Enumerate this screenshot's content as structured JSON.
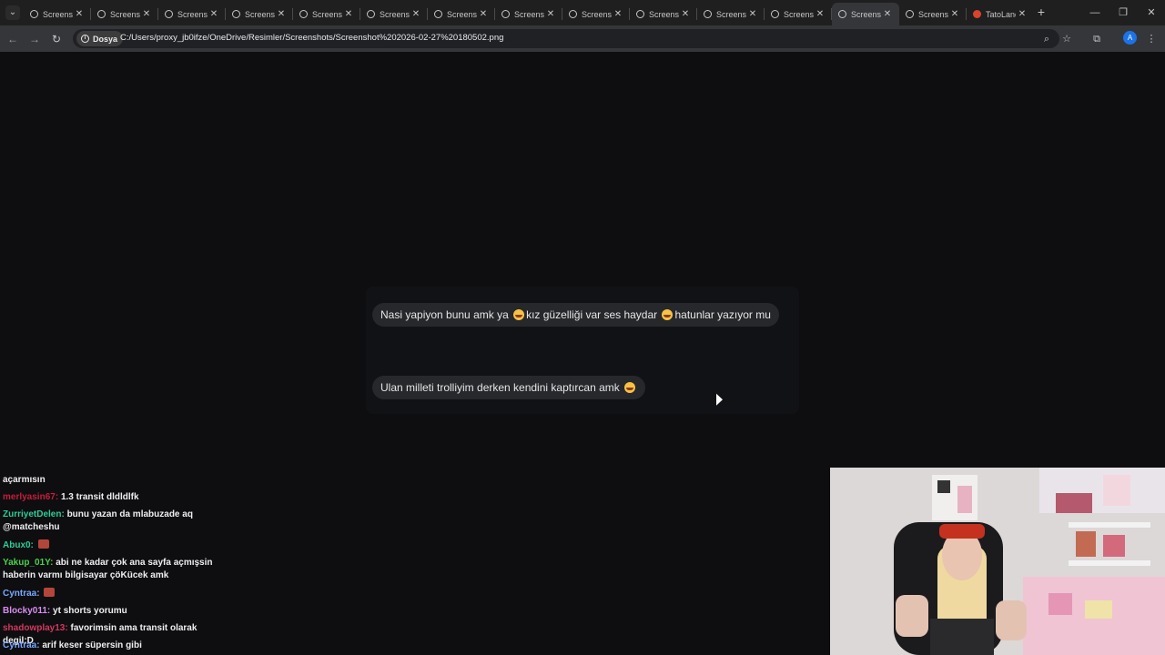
{
  "tabs": [
    {
      "label": "Screenshot",
      "favicon": "globe-icon",
      "active": false
    },
    {
      "label": "Screenshot",
      "favicon": "globe-icon",
      "active": false
    },
    {
      "label": "Screenshot",
      "favicon": "globe-icon",
      "active": false
    },
    {
      "label": "Screenshot",
      "favicon": "globe-icon",
      "active": false
    },
    {
      "label": "Screenshot",
      "favicon": "globe-icon",
      "active": false
    },
    {
      "label": "Screenshot",
      "favicon": "globe-icon",
      "active": false
    },
    {
      "label": "Screenshot",
      "favicon": "globe-icon",
      "active": false
    },
    {
      "label": "Screenshot",
      "favicon": "globe-icon",
      "active": false
    },
    {
      "label": "Screenshot",
      "favicon": "globe-icon",
      "active": false
    },
    {
      "label": "Screenshot",
      "favicon": "globe-icon",
      "active": false
    },
    {
      "label": "Screenshot",
      "favicon": "globe-icon",
      "active": false
    },
    {
      "label": "Screenshot",
      "favicon": "globe-icon",
      "active": false
    },
    {
      "label": "Screenshot",
      "favicon": "globe-icon",
      "active": true
    },
    {
      "label": "Screenshot",
      "favicon": "globe-icon",
      "active": false
    },
    {
      "label": "TatoLand",
      "favicon": "reddit-icon",
      "active": false
    }
  ],
  "toolbar": {
    "chip_label": "Dosya",
    "url": "C:/Users/proxy_jb0ifze/OneDrive/Resimler/Screenshots/Screenshot%202026-02-27%20180502.png",
    "profile_initial": "A"
  },
  "messages": [
    {
      "parts": [
        "Nasi yapiyon bunu amk ya ",
        "kız güzelliği var ses haydar ",
        "hatunlar yazıyor mu"
      ]
    },
    {
      "parts": [
        "Ulan milleti trolliyim derken kendini kaptırcan amk ",
        "",
        ""
      ]
    }
  ],
  "chat": [
    {
      "name": "",
      "color": "#efeff1",
      "text": "açarmısın",
      "sticker": false
    },
    {
      "name": "merlyasin67:",
      "color": "#c41e3a",
      "text": "1.3 transit dldldlfk",
      "sticker": false
    },
    {
      "name": "ZurriyetDelen:",
      "color": "#2ecc9a",
      "text": "bunu yazan da mlabuzade aq @matcheshu",
      "sticker": false
    },
    {
      "name": "Abux0:",
      "color": "#2ecc9a",
      "text": "",
      "sticker": true
    },
    {
      "name": "Yakup_01Y:",
      "color": "#4ad04a",
      "text": "abi ne kadar çok ana sayfa açmışsin haberin varmı bilgisayar çöKücek amk",
      "sticker": false
    },
    {
      "name": "Cyntraa:",
      "color": "#7aa7ff",
      "text": "",
      "sticker": true
    },
    {
      "name": "Blocky011:",
      "color": "#d98cf0",
      "text": "yt shorts yorumu",
      "sticker": false
    },
    {
      "name": "shadowplay13:",
      "color": "#d4365f",
      "text": "favorimsin ama transit olarak degil:D",
      "sticker": false
    },
    {
      "name": "Cyntraa:",
      "color": "#7aa7ff",
      "text": "arif keser süpersin gibi",
      "sticker": false
    }
  ]
}
